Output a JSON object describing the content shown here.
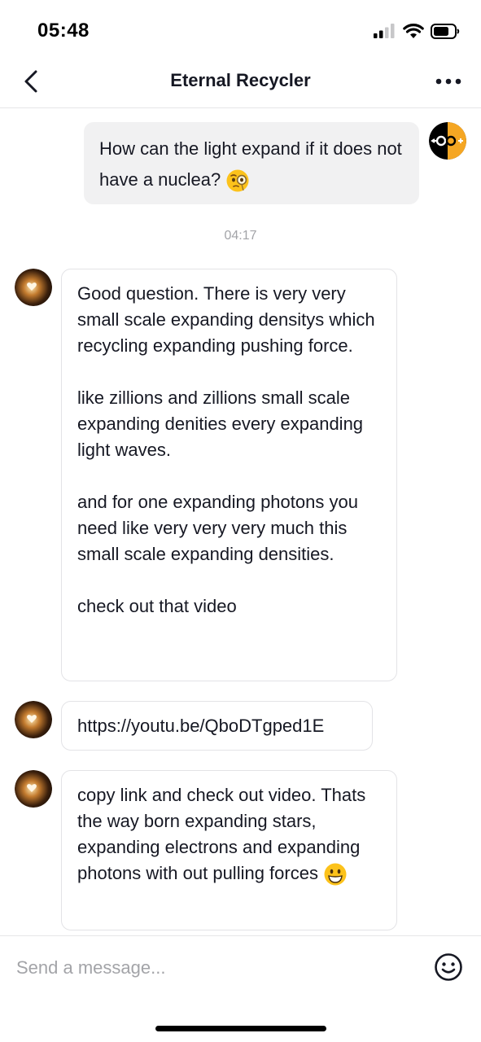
{
  "status_bar": {
    "time": "05:48"
  },
  "header": {
    "title": "Eternal Recycler"
  },
  "messages": {
    "outgoing_1": {
      "text": "How can the light expand if it does not have a nuclea?"
    },
    "timestamp": "04:17",
    "incoming_1": {
      "paragraph_1": "Good question. There is very very small scale expanding densitys which recycling expanding pushing force.",
      "paragraph_2": "like zillions and zillions small scale expanding denities every expanding light waves.",
      "paragraph_3": "and for one expanding photons you need like very very very much this small scale expanding densities.",
      "paragraph_4": "check out that video"
    },
    "incoming_2": {
      "text": "https://youtu.be/QboDTgped1E"
    },
    "incoming_3": {
      "text": "copy link and check out video. Thats the way born expanding stars, expanding electrons and expanding photons with out pulling forces"
    }
  },
  "composer": {
    "placeholder": "Send a message..."
  },
  "colors": {
    "bubble_outgoing": "#f1f1f2",
    "bubble_border": "#e3e3e6",
    "muted_text": "#a3a4a8",
    "accent_avatar": "#f5a623"
  },
  "icons": {
    "back": "chevron-left-icon",
    "more": "more-dots-icon",
    "emoji_outgoing": "face-with-monocle-emoji",
    "emoji_incoming": "grinning-face-emoji",
    "composer_emoji": "smiley-outline-icon"
  }
}
